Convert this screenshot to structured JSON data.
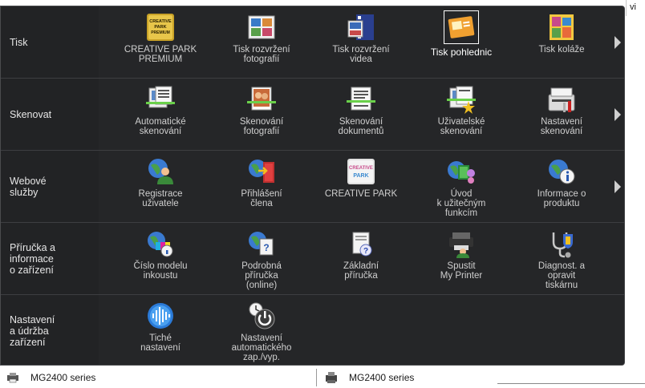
{
  "corner_text": "vi",
  "colors": {
    "panel_bg": "#1b1c1e",
    "label_bg": "#222325",
    "text": "#cfcfcf",
    "selected_text": "#ffffff"
  },
  "rows": [
    {
      "label": "Tisk",
      "items": [
        {
          "label": "CREATIVE PARK\nPREMIUM",
          "icon": "creative-park-premium-icon",
          "badge": "CREATIVE\nPARK\nPREMIUM"
        },
        {
          "label": "Tisk rozvržení\nfotografií",
          "icon": "photo-layout-icon"
        },
        {
          "label": "Tisk rozvržení\nvidea",
          "icon": "video-layout-icon"
        },
        {
          "label": "Tisk pohlednic",
          "icon": "postcard-icon",
          "selected": true
        },
        {
          "label": "Tisk koláže",
          "icon": "collage-icon"
        }
      ]
    },
    {
      "label": "Skenovat",
      "items": [
        {
          "label": "Automatické\nskenování",
          "icon": "auto-scan-icon"
        },
        {
          "label": "Skenování\nfotografií",
          "icon": "photo-scan-icon"
        },
        {
          "label": "Skenování\ndokumentů",
          "icon": "document-scan-icon"
        },
        {
          "label": "Uživatelské\nskenování",
          "icon": "custom-scan-icon"
        },
        {
          "label": "Nastavení\nskenování",
          "icon": "scan-settings-icon"
        }
      ]
    },
    {
      "label": "Webové\nslužby",
      "items": [
        {
          "label": "Registrace\nuživatele",
          "icon": "user-registration-icon"
        },
        {
          "label": "Přihlášení\nčlena",
          "icon": "member-login-icon"
        },
        {
          "label": "CREATIVE PARK",
          "icon": "creative-park-icon"
        },
        {
          "label": "Úvod\nk užitečným\nfunkcím",
          "icon": "useful-functions-icon"
        },
        {
          "label": "Informace o\nproduktu",
          "icon": "product-info-icon"
        }
      ]
    },
    {
      "label": "Příručka a\ninformace\no zařízení",
      "items": [
        {
          "label": "Číslo modelu\ninkoustu",
          "icon": "ink-model-icon"
        },
        {
          "label": "Podrobná\npříručka\n(online)",
          "icon": "online-manual-icon"
        },
        {
          "label": "Základní\npříručka",
          "icon": "basic-guide-icon"
        },
        {
          "label": "Spustit\nMy Printer",
          "icon": "my-printer-icon"
        },
        {
          "label": "Diagnost. a\nopravit\ntiskárnu",
          "icon": "diagnose-icon"
        }
      ]
    },
    {
      "label": "Nastavení\na údržba\nzařízení",
      "items": [
        {
          "label": "Tiché\nnastavení",
          "icon": "quiet-settings-icon"
        },
        {
          "label": "Nastavení\nautomatického\nzap./vyp.",
          "icon": "auto-power-icon"
        }
      ]
    }
  ],
  "taskbar": [
    {
      "label": "MG2400 series",
      "icon": "printer-icon"
    },
    {
      "label": "MG2400 series",
      "icon": "printer-icon"
    }
  ]
}
